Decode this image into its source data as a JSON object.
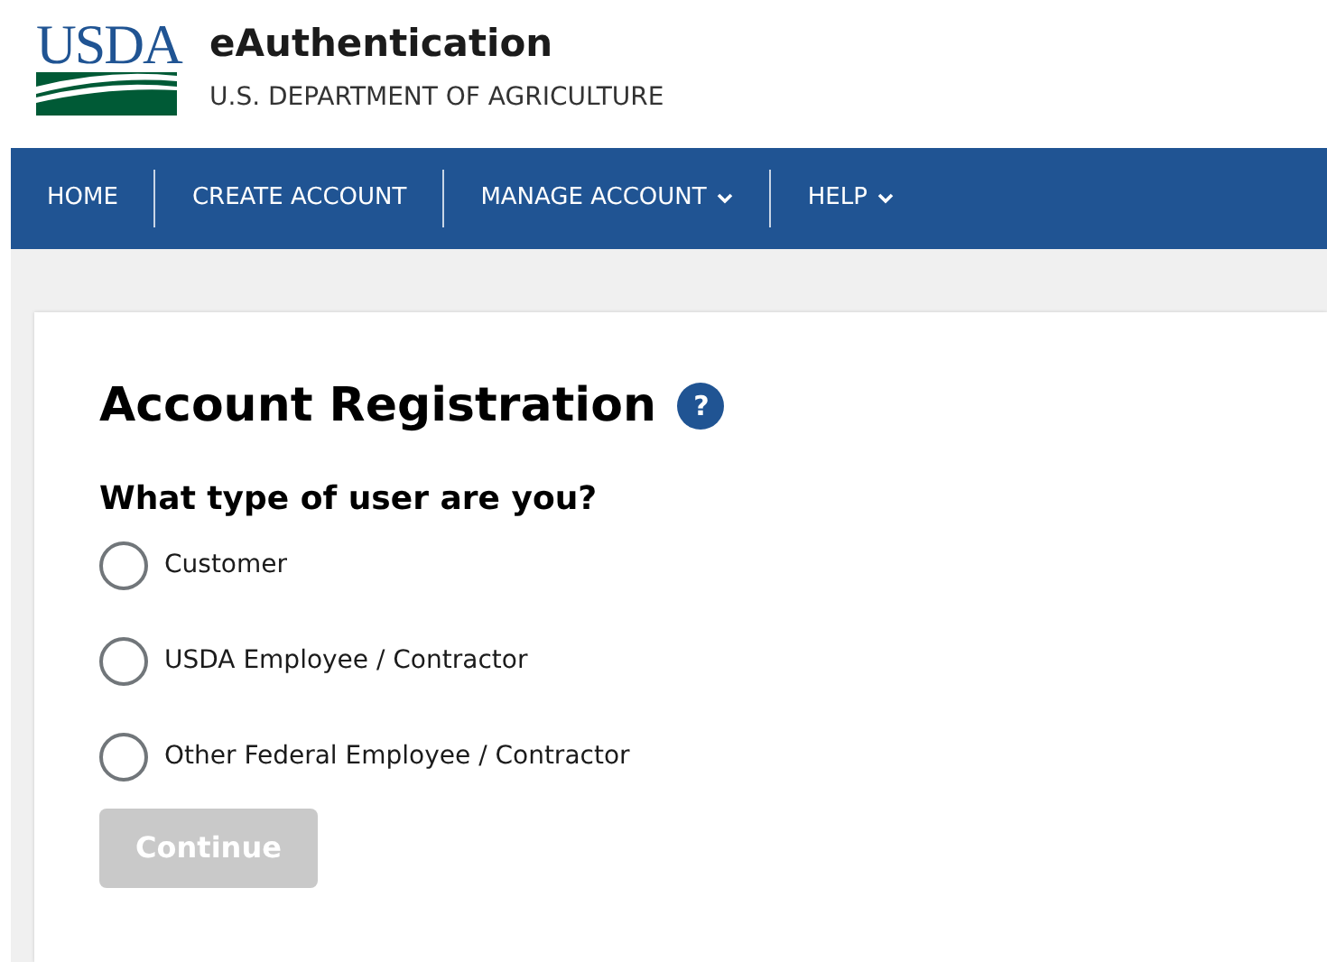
{
  "logo": {
    "text": "USDA"
  },
  "header": {
    "title": "eAuthentication",
    "subtitle": "U.S. DEPARTMENT OF AGRICULTURE"
  },
  "nav": [
    {
      "label": "HOME",
      "has_menu": false
    },
    {
      "label": "CREATE ACCOUNT",
      "has_menu": false
    },
    {
      "label": "MANAGE ACCOUNT",
      "has_menu": true
    },
    {
      "label": "HELP",
      "has_menu": true
    }
  ],
  "form": {
    "title": "Account Registration",
    "help_icon": "?",
    "question": "What type of user are you?",
    "options": [
      {
        "label": "Customer",
        "selected": false
      },
      {
        "label": "USDA Employee / Contractor",
        "selected": false
      },
      {
        "label": "Other Federal Employee / Contractor",
        "selected": false
      }
    ],
    "button": {
      "label": "Continue",
      "disabled": true
    }
  }
}
